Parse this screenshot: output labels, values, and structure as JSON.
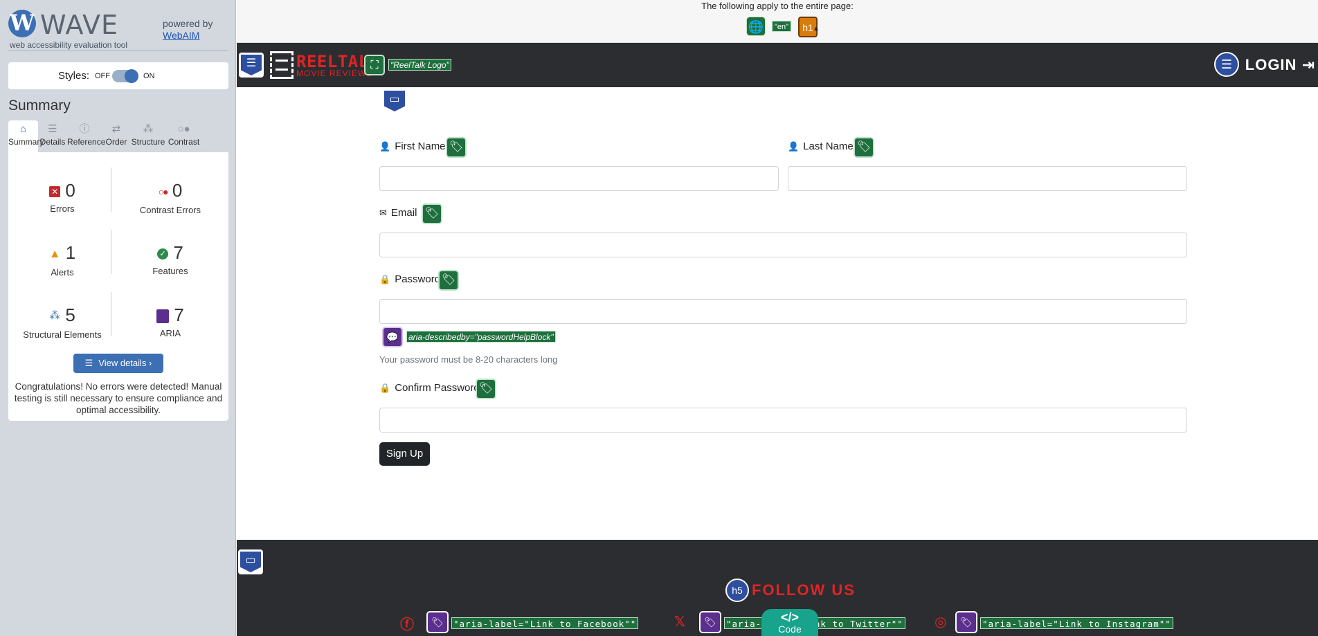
{
  "wave": {
    "title": "WAVE",
    "subtitle": "web accessibility evaluation tool",
    "powered_by": "powered by",
    "webaim_link": "WebAIM",
    "styles_label": "Styles:",
    "styles_off": "OFF",
    "styles_on": "ON",
    "summary_title": "Summary",
    "tabs": [
      {
        "label": "Summary",
        "icon": "home-icon"
      },
      {
        "label": "Details",
        "icon": "list-icon"
      },
      {
        "label": "Reference",
        "icon": "info-icon"
      },
      {
        "label": "Order",
        "icon": "order-icon"
      },
      {
        "label": "Structure",
        "icon": "structure-icon"
      },
      {
        "label": "Contrast",
        "icon": "contrast-icon"
      }
    ],
    "stats": {
      "errors": {
        "count": "0",
        "label": "Errors"
      },
      "contrast_errors": {
        "count": "0",
        "label": "Contrast Errors"
      },
      "alerts": {
        "count": "1",
        "label": "Alerts"
      },
      "features": {
        "count": "7",
        "label": "Features"
      },
      "structural": {
        "count": "5",
        "label": "Structural Elements"
      },
      "aria": {
        "count": "7",
        "label": "ARIA"
      }
    },
    "view_details": "View details ›",
    "congrats": "Congratulations! No errors were detected! Manual testing is still necessary to ensure compliance and optimal accessibility."
  },
  "page": {
    "notice": "The following apply to the entire page:",
    "lang_badge": "\"en\"",
    "h1_badge": "h1",
    "brand_title": "REELTALK",
    "brand_sub": "MOVIE REVIEWS",
    "logo_alt": "\"ReelTalk Logo\"",
    "login": "LOGIN",
    "form": {
      "first_name": "First Name",
      "last_name": "Last Name",
      "email": "Email",
      "password": "Password",
      "aria_describedby": "aria-describedby=\"passwordHelpBlock\"",
      "password_help": "Your password must be 8-20 characters long",
      "confirm_password": "Confirm Password",
      "signup": "Sign Up"
    },
    "footer": {
      "h5_badge": "h5",
      "follow": "FOLLOW US",
      "facebook_label": "\"aria-label=\"Link to Facebook\"\"",
      "twitter_label": "\"aria-label=\"Link to Twitter\"\"",
      "instagram_label": "\"aria-label=\"Link to Instagram\"\""
    },
    "code_badge": "Code"
  },
  "colors": {
    "wave_blue": "#3c6fb3",
    "navbar_bg": "#2b2d31",
    "brand_red": "#e02424",
    "wave_green": "#1e6f3d",
    "wave_purple": "#5a2f8e",
    "alert_orange": "#d97b0d"
  }
}
